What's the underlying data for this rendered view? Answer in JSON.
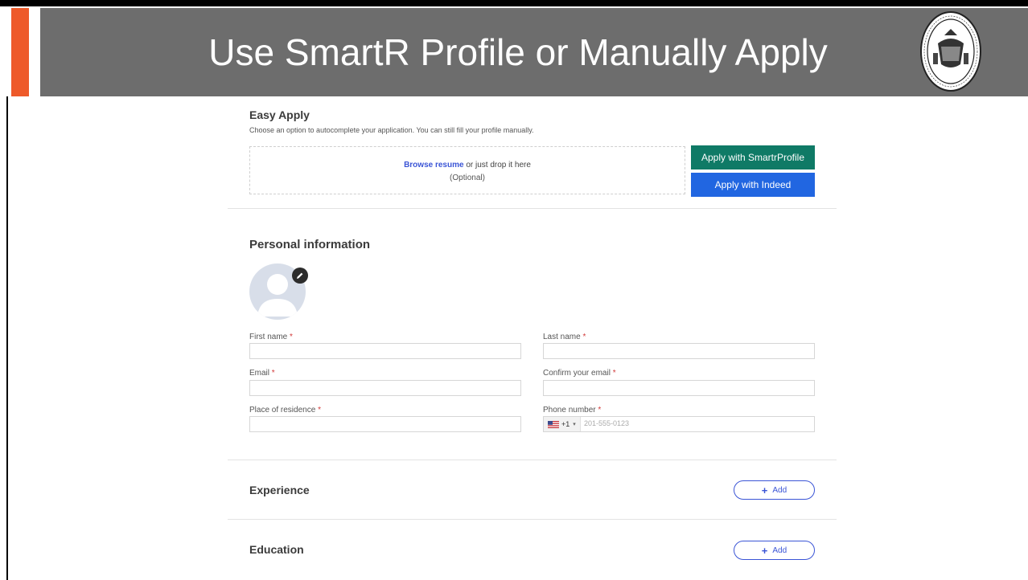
{
  "slide": {
    "title": "Use SmartR Profile or Manually Apply"
  },
  "easy_apply": {
    "heading": "Easy Apply",
    "description": "Choose an option to autocomplete your application. You can still fill your profile manually.",
    "browse_link": "Browse resume",
    "drop_text": " or just drop it here",
    "optional": "(Optional)",
    "smartr_button": "Apply with SmartrProfile",
    "indeed_button": "Apply with Indeed"
  },
  "personal_info": {
    "heading": "Personal information",
    "required_marker": "*",
    "fields": {
      "first_name": "First name",
      "last_name": "Last name",
      "email": "Email",
      "confirm_email": "Confirm your email",
      "residence": "Place of residence",
      "phone": "Phone number"
    },
    "phone_code": "+1",
    "phone_placeholder": "201-555-0123"
  },
  "experience": {
    "heading": "Experience",
    "add_label": "Add"
  },
  "education": {
    "heading": "Education",
    "add_label": "Add"
  },
  "colors": {
    "accent": "#ee5a2a",
    "title_bar": "#6d6d6d",
    "smartr_green": "#0f7a66",
    "indeed_blue": "#2166e1",
    "link_blue": "#3b55d6"
  },
  "icons": [
    "seal-logo",
    "avatar-icon",
    "pencil-icon",
    "us-flag-icon",
    "chevron-down-icon",
    "plus-icon"
  ]
}
